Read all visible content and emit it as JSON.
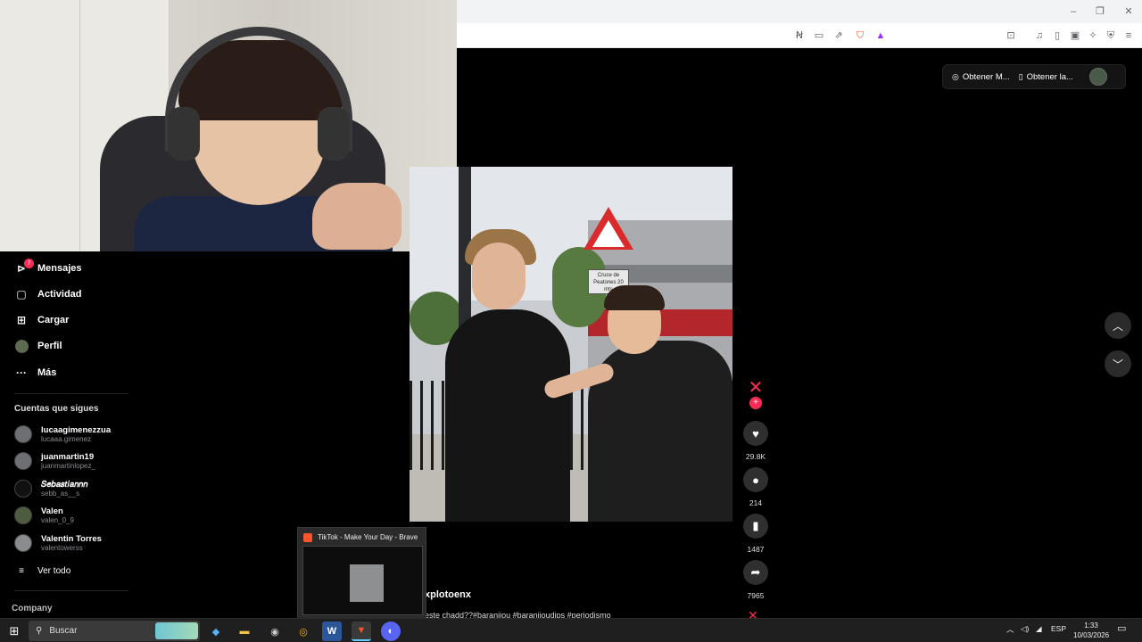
{
  "browser": {
    "title_controls": {
      "minimize": "–",
      "maximize": "❐",
      "close": "✕"
    },
    "toolbar_icons": [
      "translate-icon",
      "cast-icon",
      "share-icon",
      "brave-shields-icon",
      "brave-rewards-icon",
      "screenshot-icon",
      "media-icon",
      "sidebar-icon",
      "wallet-icon",
      "leo-icon",
      "vpn-icon",
      "menu-icon"
    ]
  },
  "topbar": {
    "get_app_label": "Obtener M...",
    "get_desktop_label": "Obtener la..."
  },
  "nav": {
    "items": [
      {
        "label": "Mensajes",
        "icon": "send-icon",
        "badge": "7"
      },
      {
        "label": "Actividad",
        "icon": "inbox-icon"
      },
      {
        "label": "Cargar",
        "icon": "plus-square-icon"
      },
      {
        "label": "Perfil",
        "icon": "avatar-icon"
      },
      {
        "label": "Más",
        "icon": "more-icon"
      }
    ],
    "following_title": "Cuentas que sigues",
    "accounts": [
      {
        "name": "lucaagimenezzua",
        "handle": "lucaaa.gimenez"
      },
      {
        "name": "juanmartin19",
        "handle": "juanmartinlopez_"
      },
      {
        "name": "𝑆𝑒𝑏𝑎𝑠𝑡𝑖𝑎𝑛𝑛𝑛",
        "handle": "sebb_as__s"
      },
      {
        "name": "Valen",
        "handle": "valen_0_9"
      },
      {
        "name": "Valentin Torres",
        "handle": "valentowerss"
      }
    ],
    "see_all": "Ver todo",
    "company": "Company"
  },
  "video": {
    "sign_text": "Cruce de Peatones 20 mts",
    "author": "xplotoenx",
    "caption": "este chadd??#baranijou #baranijoudips #periodismo"
  },
  "actions": {
    "likes": "29.8K",
    "comments": "214",
    "saves": "1487",
    "shares": "7965"
  },
  "preview": {
    "title": "TikTok - Make Your Day - Brave"
  },
  "taskbar": {
    "search_placeholder": "Buscar",
    "lang": "ESP",
    "time": "1:33",
    "date": "10/03/2026"
  },
  "colors": {
    "accent": "#fe2c55",
    "background": "#000000",
    "taskbar": "#1f1f1f"
  }
}
